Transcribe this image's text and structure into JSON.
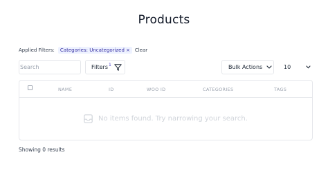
{
  "page": {
    "title": "Products"
  },
  "applied_filters": {
    "label": "Applied Filters:",
    "chips": [
      {
        "label": "Categories: Uncategorized",
        "remove": "×"
      }
    ],
    "clear_label": "Clear"
  },
  "toolbar": {
    "search_placeholder": "Search",
    "filters_label": "Filters",
    "filters_count": "1",
    "bulk_actions_label": "Bulk Actions",
    "per_page_value": "10"
  },
  "table": {
    "columns": [
      "NAME",
      "ID",
      "WOO ID",
      "CATEGORIES",
      "TAGS"
    ],
    "empty_message": "No items found. Try narrowing your search."
  },
  "footer": {
    "results_text": "Showing 0 results"
  },
  "colors": {
    "chip_bg": "#eef2ff",
    "chip_text": "#3730a3",
    "border": "#e5e7eb"
  },
  "icons": [
    "filter-icon",
    "chevron-down-icon",
    "checkbox-icon"
  ]
}
